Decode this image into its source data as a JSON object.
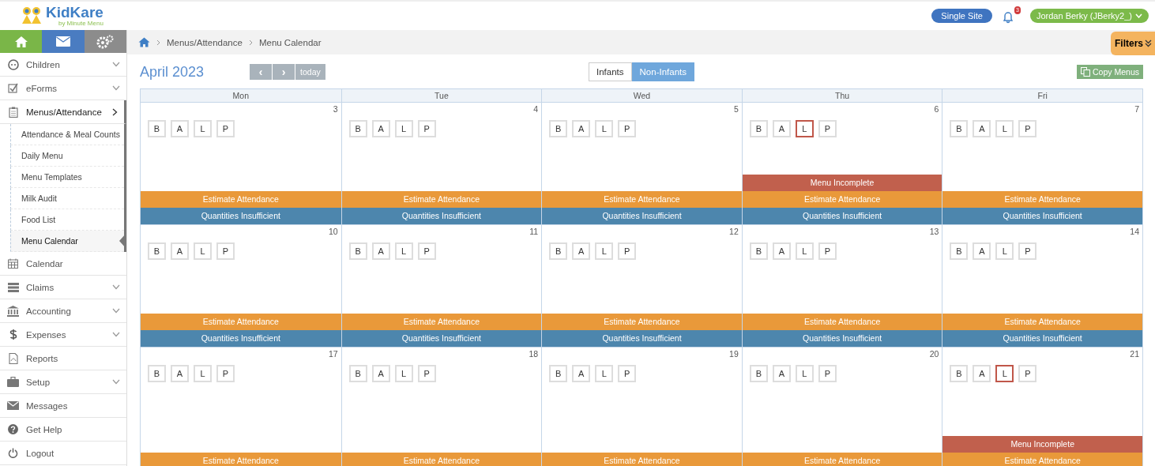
{
  "logo": {
    "name": "KidKare",
    "tagline": "by Minute Menu"
  },
  "header": {
    "site_button": "Single Site",
    "notification_count": "3",
    "user": "Jordan Berky (JBerky2_)"
  },
  "sidebar": {
    "items": [
      {
        "label": "Children",
        "expanded": false,
        "selected": false
      },
      {
        "label": "eForms",
        "expanded": false,
        "selected": false
      },
      {
        "label": "Menus/Attendance",
        "expanded": true,
        "selected": true,
        "children": [
          {
            "label": "Attendance & Meal Counts",
            "selected": false
          },
          {
            "label": "Daily Menu",
            "selected": false
          },
          {
            "label": "Menu Templates",
            "selected": false
          },
          {
            "label": "Milk Audit",
            "selected": false
          },
          {
            "label": "Food List",
            "selected": false
          },
          {
            "label": "Menu Calendar",
            "selected": true
          }
        ]
      },
      {
        "label": "Calendar",
        "selected": false
      },
      {
        "label": "Claims",
        "expanded": false,
        "selected": false
      },
      {
        "label": "Accounting",
        "expanded": false,
        "selected": false
      },
      {
        "label": "Expenses",
        "expanded": false,
        "selected": false
      },
      {
        "label": "Reports",
        "selected": false
      },
      {
        "label": "Setup",
        "expanded": false,
        "selected": false
      },
      {
        "label": "Messages",
        "selected": false
      },
      {
        "label": "Get Help",
        "selected": false
      },
      {
        "label": "Logout",
        "selected": false
      }
    ]
  },
  "breadcrumb": [
    "Menus/Attendance",
    "Menu Calendar"
  ],
  "filters_button": "Filters",
  "calendar": {
    "title": "April 2023",
    "today_button": "today",
    "prev_symbol": "‹",
    "next_symbol": "›",
    "tabs": [
      {
        "label": "Infants",
        "selected": false
      },
      {
        "label": "Non-Infants",
        "selected": true
      }
    ],
    "copy_button": "Copy Menus",
    "weekdays": [
      "Mon",
      "Tue",
      "Wed",
      "Thu",
      "Fri"
    ],
    "weeks": [
      {
        "days": [
          {
            "date": "3",
            "meals": [
              {
                "label": "B",
                "flagged": false
              },
              {
                "label": "A",
                "flagged": false
              },
              {
                "label": "L",
                "flagged": false
              },
              {
                "label": "P",
                "flagged": false
              }
            ],
            "events": [
              {
                "kind": "estimate",
                "label": "Estimate Attendance"
              },
              {
                "kind": "quantities",
                "label": "Quantities Insufficient"
              }
            ]
          },
          {
            "date": "4",
            "meals": [
              {
                "label": "B",
                "flagged": false
              },
              {
                "label": "A",
                "flagged": false
              },
              {
                "label": "L",
                "flagged": false
              },
              {
                "label": "P",
                "flagged": false
              }
            ],
            "events": [
              {
                "kind": "estimate",
                "label": "Estimate Attendance"
              },
              {
                "kind": "quantities",
                "label": "Quantities Insufficient"
              }
            ]
          },
          {
            "date": "5",
            "meals": [
              {
                "label": "B",
                "flagged": false
              },
              {
                "label": "A",
                "flagged": false
              },
              {
                "label": "L",
                "flagged": false
              },
              {
                "label": "P",
                "flagged": false
              }
            ],
            "events": [
              {
                "kind": "estimate",
                "label": "Estimate Attendance"
              },
              {
                "kind": "quantities",
                "label": "Quantities Insufficient"
              }
            ]
          },
          {
            "date": "6",
            "meals": [
              {
                "label": "B",
                "flagged": false
              },
              {
                "label": "A",
                "flagged": false
              },
              {
                "label": "L",
                "flagged": true
              },
              {
                "label": "P",
                "flagged": false
              }
            ],
            "events": [
              {
                "kind": "incomplete",
                "label": "Menu Incomplete"
              },
              {
                "kind": "estimate",
                "label": "Estimate Attendance"
              },
              {
                "kind": "quantities",
                "label": "Quantities Insufficient"
              }
            ]
          },
          {
            "date": "7",
            "meals": [
              {
                "label": "B",
                "flagged": false
              },
              {
                "label": "A",
                "flagged": false
              },
              {
                "label": "L",
                "flagged": false
              },
              {
                "label": "P",
                "flagged": false
              }
            ],
            "events": [
              {
                "kind": "estimate",
                "label": "Estimate Attendance"
              },
              {
                "kind": "quantities",
                "label": "Quantities Insufficient"
              }
            ]
          }
        ]
      },
      {
        "days": [
          {
            "date": "10",
            "meals": [
              {
                "label": "B",
                "flagged": false
              },
              {
                "label": "A",
                "flagged": false
              },
              {
                "label": "L",
                "flagged": false
              },
              {
                "label": "P",
                "flagged": false
              }
            ],
            "events": [
              {
                "kind": "estimate",
                "label": "Estimate Attendance"
              },
              {
                "kind": "quantities",
                "label": "Quantities Insufficient"
              }
            ]
          },
          {
            "date": "11",
            "meals": [
              {
                "label": "B",
                "flagged": false
              },
              {
                "label": "A",
                "flagged": false
              },
              {
                "label": "L",
                "flagged": false
              },
              {
                "label": "P",
                "flagged": false
              }
            ],
            "events": [
              {
                "kind": "estimate",
                "label": "Estimate Attendance"
              },
              {
                "kind": "quantities",
                "label": "Quantities Insufficient"
              }
            ]
          },
          {
            "date": "12",
            "meals": [
              {
                "label": "B",
                "flagged": false
              },
              {
                "label": "A",
                "flagged": false
              },
              {
                "label": "L",
                "flagged": false
              },
              {
                "label": "P",
                "flagged": false
              }
            ],
            "events": [
              {
                "kind": "estimate",
                "label": "Estimate Attendance"
              },
              {
                "kind": "quantities",
                "label": "Quantities Insufficient"
              }
            ]
          },
          {
            "date": "13",
            "meals": [
              {
                "label": "B",
                "flagged": false
              },
              {
                "label": "A",
                "flagged": false
              },
              {
                "label": "L",
                "flagged": false
              },
              {
                "label": "P",
                "flagged": false
              }
            ],
            "events": [
              {
                "kind": "estimate",
                "label": "Estimate Attendance"
              },
              {
                "kind": "quantities",
                "label": "Quantities Insufficient"
              }
            ]
          },
          {
            "date": "14",
            "meals": [
              {
                "label": "B",
                "flagged": false
              },
              {
                "label": "A",
                "flagged": false
              },
              {
                "label": "L",
                "flagged": false
              },
              {
                "label": "P",
                "flagged": false
              }
            ],
            "events": [
              {
                "kind": "estimate",
                "label": "Estimate Attendance"
              },
              {
                "kind": "quantities",
                "label": "Quantities Insufficient"
              }
            ]
          }
        ]
      },
      {
        "days": [
          {
            "date": "17",
            "meals": [
              {
                "label": "B",
                "flagged": false
              },
              {
                "label": "A",
                "flagged": false
              },
              {
                "label": "L",
                "flagged": false
              },
              {
                "label": "P",
                "flagged": false
              }
            ],
            "events": [
              {
                "kind": "estimate",
                "label": "Estimate Attendance"
              }
            ]
          },
          {
            "date": "18",
            "meals": [
              {
                "label": "B",
                "flagged": false
              },
              {
                "label": "A",
                "flagged": false
              },
              {
                "label": "L",
                "flagged": false
              },
              {
                "label": "P",
                "flagged": false
              }
            ],
            "events": [
              {
                "kind": "estimate",
                "label": "Estimate Attendance"
              }
            ]
          },
          {
            "date": "19",
            "meals": [
              {
                "label": "B",
                "flagged": false
              },
              {
                "label": "A",
                "flagged": false
              },
              {
                "label": "L",
                "flagged": false
              },
              {
                "label": "P",
                "flagged": false
              }
            ],
            "events": [
              {
                "kind": "estimate",
                "label": "Estimate Attendance"
              }
            ]
          },
          {
            "date": "20",
            "meals": [
              {
                "label": "B",
                "flagged": false
              },
              {
                "label": "A",
                "flagged": false
              },
              {
                "label": "L",
                "flagged": false
              },
              {
                "label": "P",
                "flagged": false
              }
            ],
            "events": [
              {
                "kind": "estimate",
                "label": "Estimate Attendance"
              }
            ]
          },
          {
            "date": "21",
            "meals": [
              {
                "label": "B",
                "flagged": false
              },
              {
                "label": "A",
                "flagged": false
              },
              {
                "label": "L",
                "flagged": true
              },
              {
                "label": "P",
                "flagged": false
              }
            ],
            "events": [
              {
                "kind": "incomplete",
                "label": "Menu Incomplete"
              },
              {
                "kind": "estimate",
                "label": "Estimate Attendance"
              }
            ]
          }
        ]
      }
    ]
  }
}
